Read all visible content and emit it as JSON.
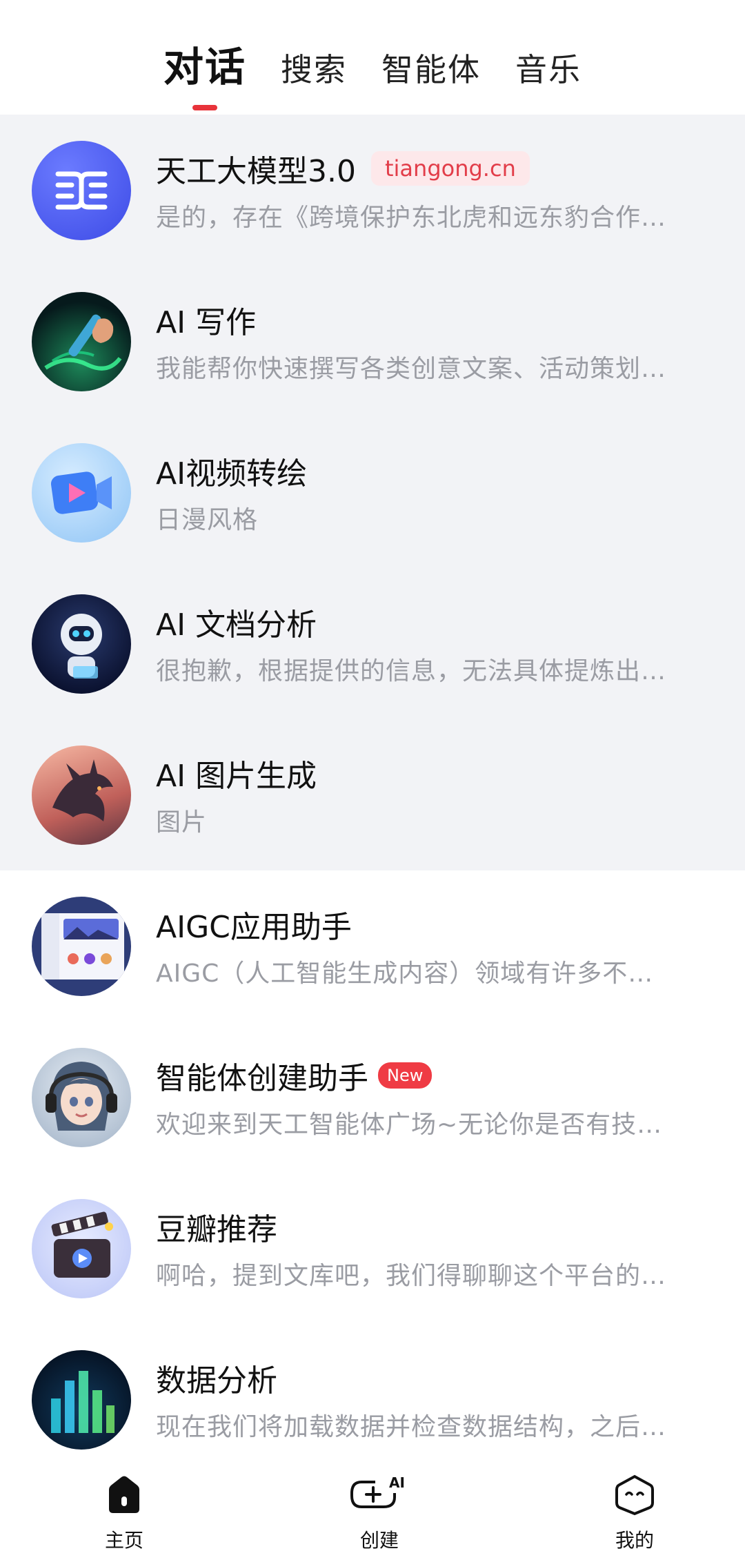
{
  "tabs": [
    {
      "label": "对话",
      "active": true
    },
    {
      "label": "搜索",
      "active": false
    },
    {
      "label": "智能体",
      "active": false
    },
    {
      "label": "音乐",
      "active": false
    }
  ],
  "chats": [
    {
      "title": "天工大模型3.0",
      "tag": "tiangong.cn",
      "subtitle": "是的，存在《跨境保护东北虎和远东豹合作…",
      "icon": "tiangong-logo-icon"
    },
    {
      "title": "AI 写作",
      "subtitle": "我能帮你快速撰写各类创意文案、活动策划…",
      "icon": "writing-hand-icon"
    },
    {
      "title": "AI视频转绘",
      "subtitle": "日漫风格",
      "icon": "video-camera-icon"
    },
    {
      "title": "AI 文档分析",
      "subtitle": "很抱歉，根据提供的信息，无法具体提炼出…",
      "icon": "robot-icon"
    },
    {
      "title": "AI 图片生成",
      "subtitle": "图片",
      "icon": "dragon-image-icon"
    },
    {
      "title": "AIGC应用助手",
      "subtitle": "AIGC（人工智能生成内容）领域有许多不…",
      "icon": "app-screenshot-icon"
    },
    {
      "title": "智能体创建助手",
      "badge": "New",
      "subtitle": "欢迎来到天工智能体广场~无论你是否有技…",
      "icon": "anime-assistant-icon"
    },
    {
      "title": "豆瓣推荐",
      "subtitle": "啊哈，提到文库吧，我们得聊聊这个平台的…",
      "icon": "clapperboard-icon"
    },
    {
      "title": "数据分析",
      "subtitle": "现在我们将加载数据并检查数据结构，之后…",
      "icon": "bar-chart-icon"
    }
  ],
  "nav": [
    {
      "label": "主页",
      "icon": "home-icon"
    },
    {
      "label": "创建",
      "icon": "create-ai-icon",
      "icon_text": "AI"
    },
    {
      "label": "我的",
      "icon": "profile-face-icon"
    }
  ],
  "colors": {
    "accent": "#e8333a",
    "pinned_bg": "#f2f3f6",
    "tag_text": "#e23d49",
    "tag_bg": "#fde8ea",
    "badge_bg": "#ef3b44"
  }
}
